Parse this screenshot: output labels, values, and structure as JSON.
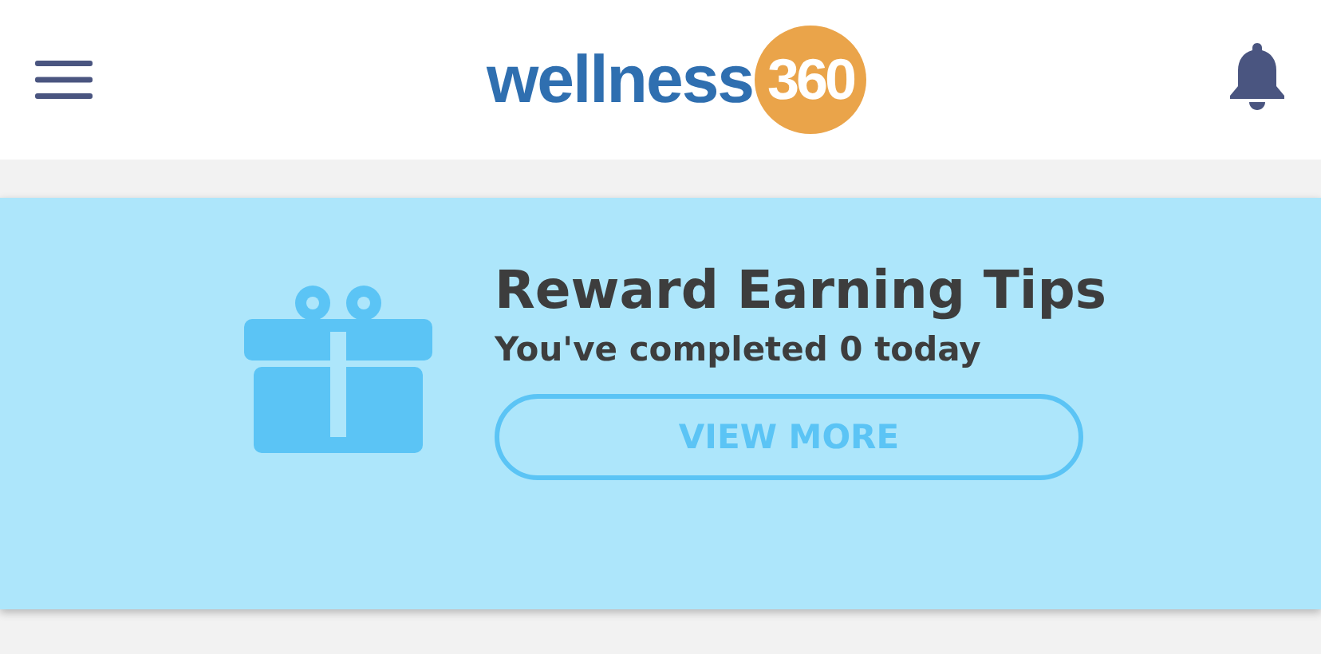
{
  "header": {
    "logo": {
      "word": "wellness",
      "number": "360"
    }
  },
  "card": {
    "title": "Reward Earning Tips",
    "subtitle": "You've completed 0 today",
    "button": "VIEW MORE"
  }
}
